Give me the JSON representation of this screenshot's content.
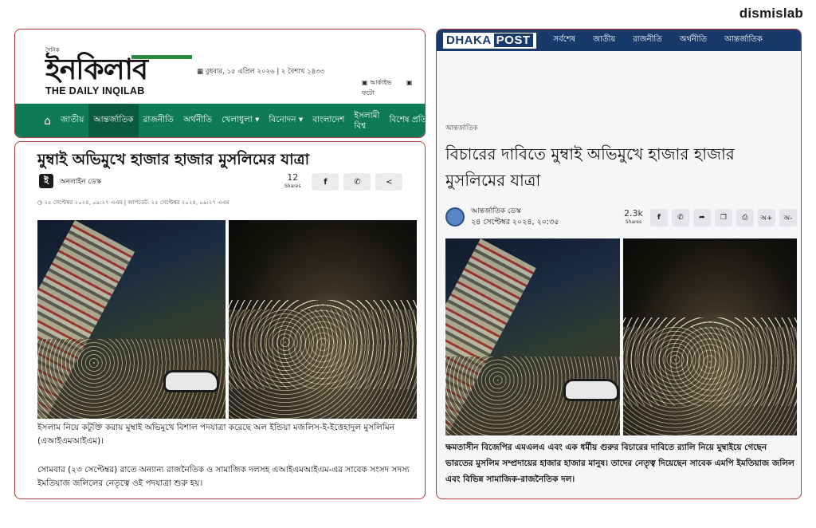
{
  "brand": "dismislab",
  "inqilab": {
    "logo_small": "দৈনিক",
    "logo_bn": "ইনকিলাব",
    "logo_en": "THE DAILY INQILAB",
    "date": "▦ বুধবার, ১৫ এপ্রিল ২০২৬ | ২ বৈশাখ ১৪৩৩",
    "archive": "আর্কাইভ",
    "photo": "ফটো",
    "nav": [
      "জাতীয়",
      "আন্তর্জাতিক",
      "রাজনীতি",
      "অর্থনীতি",
      "খেলাধুলা ▾",
      "বিনোদন ▾",
      "বাংলাদেশ",
      "ইসলামী বিশ্ব",
      "বিশেষ প্রতিবেদন"
    ],
    "title": "মুম্বাই অভিমুখে হাজার হাজার মুসলিমের যাত্রা",
    "author": "অনলাইন ডেস্ক",
    "shares_count": "12",
    "shares_label": "Shares",
    "meta": "◷ ২৫ সেপ্টেম্বর ২০২৪, ০৯:২৭ এএম | আপডেট: ২৫ সেপ্টেম্বর ২০২৪, ০৯:২৭ এএম",
    "p1": "ইসলাম নিয়ে কটূক্তি করায় মুম্বাই অভিমুখে বিশাল পদযাত্রা করেছে অল ইন্ডিয়া মজলিস-ই-ইত্তেহাদুল মুসলিমিন (এআইএমআইএম)।",
    "p2": "সোমবার (২৩ সেপ্টেম্বর) রাতে অন্যান্য রাজনৈতিক ও সামাজিক দলসহ এআইএমআইএম-এর সাবেক সংসদ সদস্য ইমতিয়াজ জলিলের নেতৃত্বে ওই পদযাত্রা শুরু হয়।"
  },
  "dhakapost": {
    "logo_a": "DHAKA",
    "logo_b": "POST",
    "nav": [
      "সর্বশেষ",
      "জাতীয়",
      "রাজনীতি",
      "অর্থনীতি",
      "আন্তর্জাতিক"
    ],
    "category": "আন্তর্জাতিক",
    "title": "বিচারের দাবিতে মুম্বাই অভিমুখে হাজার হাজার মুসলিমের যাত্রা",
    "author": "আন্তর্জাতিক ডেস্ক",
    "date": "২৪ সেপ্টেম্বর ২০২৪, ২০:৩৫",
    "shares_count": "2.3k",
    "shares_label": "Shares",
    "font_plus": "অ+",
    "font_minus": "অ-",
    "body": "ক্ষমতাসীন বিজেপির এমএলএ এবং এক ধর্মীয় গুরুর বিচারের দাবিতে র‍্যালি নিয়ে মুম্বাইয়ে গেছেন ভারতের মুসলিম সম্প্রদায়ের হাজার হাজার মানুষ। তাদের নেতৃত্ব দিয়েছেন সাবেক এমপি ইমতিয়াজ জলিল এবং বিভিন্ন সামাজিক-রাজনৈতিক দল।"
  },
  "colors": {
    "inq_nav": "#0f7a56",
    "dp_nav": "#183a6b",
    "panel_border": "#b23a3a"
  }
}
